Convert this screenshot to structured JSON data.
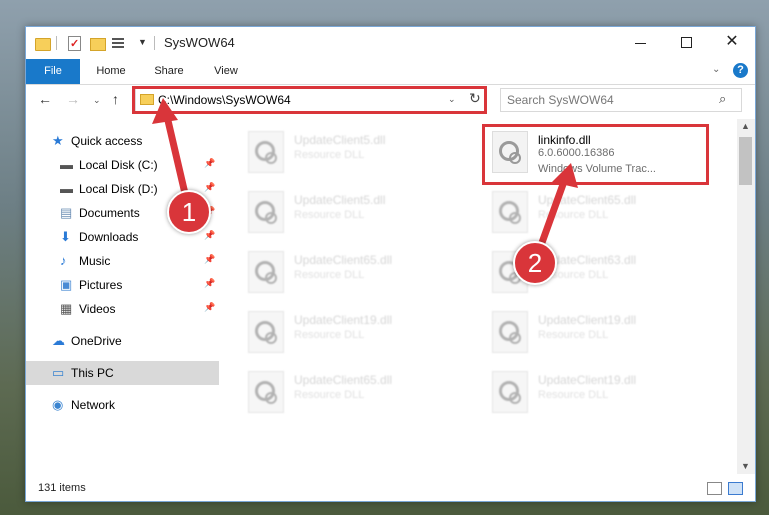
{
  "window": {
    "title": "SysWOW64",
    "controls": {
      "minimize": "minimize",
      "maximize": "maximize",
      "close": "✕"
    }
  },
  "ribbon": {
    "tabs": [
      "File",
      "Home",
      "Share",
      "View"
    ],
    "help": "?"
  },
  "navigation": {
    "address": "C:\\Windows\\SysWOW64",
    "search_placeholder": "Search SysWOW64"
  },
  "sidebar": {
    "items": [
      {
        "label": "Quick access",
        "icon": "star-icon"
      },
      {
        "label": "Local Disk (C:)",
        "icon": "drive-icon",
        "pinned": true
      },
      {
        "label": "Local Disk (D:)",
        "icon": "drive-icon",
        "pinned": true
      },
      {
        "label": "Documents",
        "icon": "documents-icon",
        "pinned": true
      },
      {
        "label": "Downloads",
        "icon": "download-icon",
        "pinned": true
      },
      {
        "label": "Music",
        "icon": "music-icon",
        "pinned": true
      },
      {
        "label": "Pictures",
        "icon": "pictures-icon",
        "pinned": true
      },
      {
        "label": "Videos",
        "icon": "videos-icon",
        "pinned": true
      },
      {
        "label": "OneDrive",
        "icon": "cloud-icon"
      },
      {
        "label": "This PC",
        "icon": "computer-icon",
        "selected": true
      },
      {
        "label": "Network",
        "icon": "network-icon"
      }
    ]
  },
  "files": [
    {
      "name": "UpdateClient5.dll",
      "desc": "Resource DLL"
    },
    {
      "name": "linkinfo.dll",
      "version": "6.0.6000.16386",
      "desc": "Windows Volume Trac...",
      "highlighted": true
    },
    {
      "name": "UpdateClient5.dll",
      "desc": "Resource DLL"
    },
    {
      "name": "UpdateClient65.dll",
      "desc": "Resource DLL"
    },
    {
      "name": "UpdateClient65.dll",
      "desc": "Resource DLL"
    },
    {
      "name": "UpdateClient63.dll",
      "desc": "Resource DLL"
    },
    {
      "name": "UpdateClient19.dll",
      "desc": "Resource DLL"
    },
    {
      "name": "UpdateClient19.dll",
      "desc": "Resource DLL"
    },
    {
      "name": "UpdateClient65.dll",
      "desc": "Resource DLL"
    },
    {
      "name": "UpdateClient19.dll",
      "desc": "Resource DLL"
    }
  ],
  "status": {
    "item_count": "131 items"
  },
  "annotations": {
    "step1": "1",
    "step2": "2",
    "color": "#d9353a"
  }
}
